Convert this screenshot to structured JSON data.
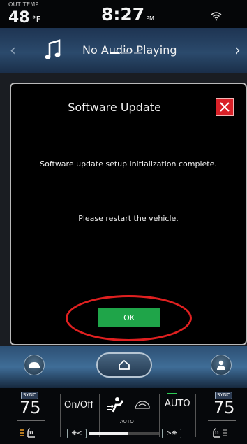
{
  "status": {
    "out_temp_label": "OUT TEMP",
    "out_temp_value": "48",
    "out_temp_unit": "°F",
    "clock": "8:27",
    "clock_ampm": "PM",
    "wifi_icon": "wifi-icon"
  },
  "audio": {
    "title": "No Audio Playing",
    "prev_glyph": "‹",
    "next_glyph": "›",
    "icon": "music-note-icon",
    "page_count": 3,
    "active_page": 1
  },
  "dialog": {
    "title": "Software Update",
    "message_1": "Software update setup initialization complete.",
    "message_2": "Please restart the vehicle.",
    "ok_label": "OK",
    "close_icon": "close-icon",
    "close_color": "#d92128",
    "ok_color": "#1fa549",
    "highlight_color": "#e02020"
  },
  "nav": {
    "left_icon": "car-icon",
    "center_icon": "home-icon",
    "right_icon": "user-icon"
  },
  "climate": {
    "left": {
      "sync_label": "SYNC",
      "temperature": "75"
    },
    "right": {
      "sync_label": "SYNC",
      "temperature": "75"
    },
    "onoff_label": "On/Off",
    "auto_label": "AUTO",
    "mode_label": "AUTO",
    "fan_down_label": "❋<",
    "fan_up_label": ">❋",
    "fan_level": 0.55,
    "auto_indicator_color": "#2ccb55"
  }
}
